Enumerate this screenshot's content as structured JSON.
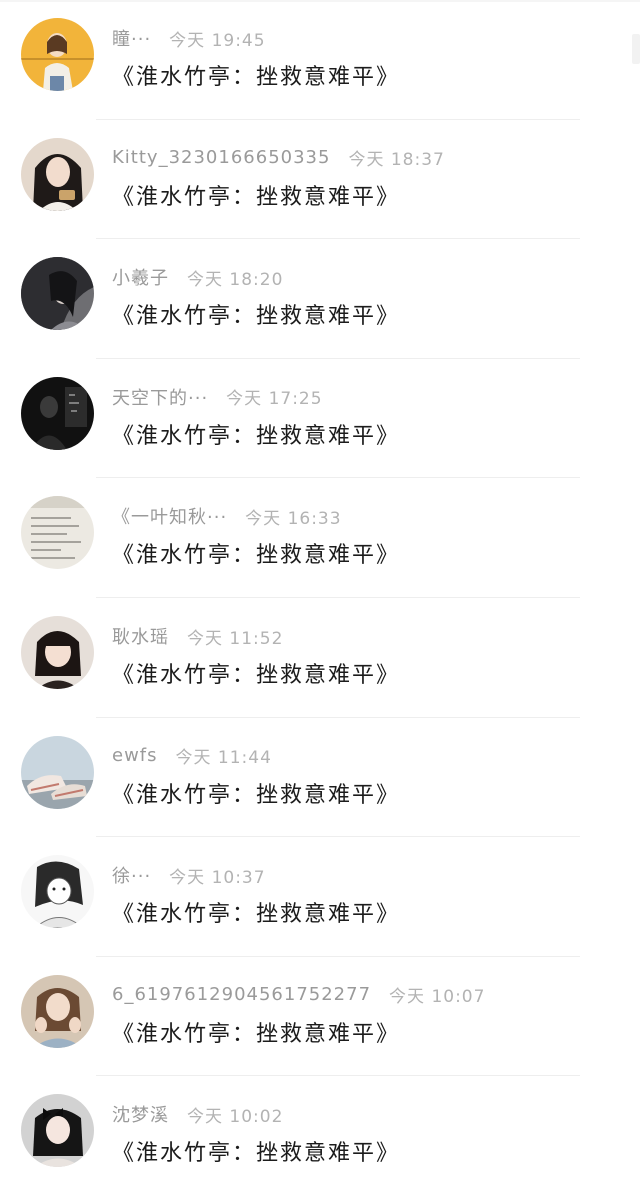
{
  "comments": [
    {
      "name": "瞳···",
      "time": "今天 19:45",
      "message": "《淮水竹亭：挫救意难平》",
      "avatar_icon": "avatar-yellow-girl",
      "avatar_color": "#f2b43a"
    },
    {
      "name": "Kitty_3230166650335",
      "time": "今天 18:37",
      "message": "《淮水竹亭：挫救意难平》",
      "avatar_icon": "avatar-girl-portrait",
      "avatar_color": "#d9c8b8"
    },
    {
      "name": "小羲子",
      "time": "今天 18:20",
      "message": "《淮水竹亭：挫救意难平》",
      "avatar_icon": "avatar-dark-hair",
      "avatar_color": "#3b3b3f"
    },
    {
      "name": "天空下的···",
      "time": "今天 17:25",
      "message": "《淮水竹亭：挫救意难平》",
      "avatar_icon": "avatar-dark-silhouette",
      "avatar_color": "#1e1e1e"
    },
    {
      "name": "《一叶知秋···",
      "time": "今天 16:33",
      "message": "《淮水竹亭：挫救意难平》",
      "avatar_icon": "avatar-paper-notes",
      "avatar_color": "#e9e6df"
    },
    {
      "name": "耿水瑶",
      "time": "今天 11:52",
      "message": "《淮水竹亭：挫救意难平》",
      "avatar_icon": "avatar-child-portrait",
      "avatar_color": "#d8cfc8"
    },
    {
      "name": "ewfs",
      "time": "今天 11:44",
      "message": "《淮水竹亭：挫救意难平》",
      "avatar_icon": "avatar-shoes-sky",
      "avatar_color": "#b9c7d2"
    },
    {
      "name": "徐···",
      "time": "今天 10:37",
      "message": "《淮水竹亭：挫救意难平》",
      "avatar_icon": "avatar-anime-sketch",
      "avatar_color": "#efefef"
    },
    {
      "name": "6_6197612904561752277",
      "time": "今天 10:07",
      "message": "《淮水竹亭：挫救意难平》",
      "avatar_icon": "avatar-girl-hands",
      "avatar_color": "#c6b39d"
    },
    {
      "name": "沈梦溪",
      "time": "今天 10:02",
      "message": "《淮水竹亭：挫救意难平》",
      "avatar_icon": "avatar-girl-bow",
      "avatar_color": "#bfbfbf"
    }
  ]
}
